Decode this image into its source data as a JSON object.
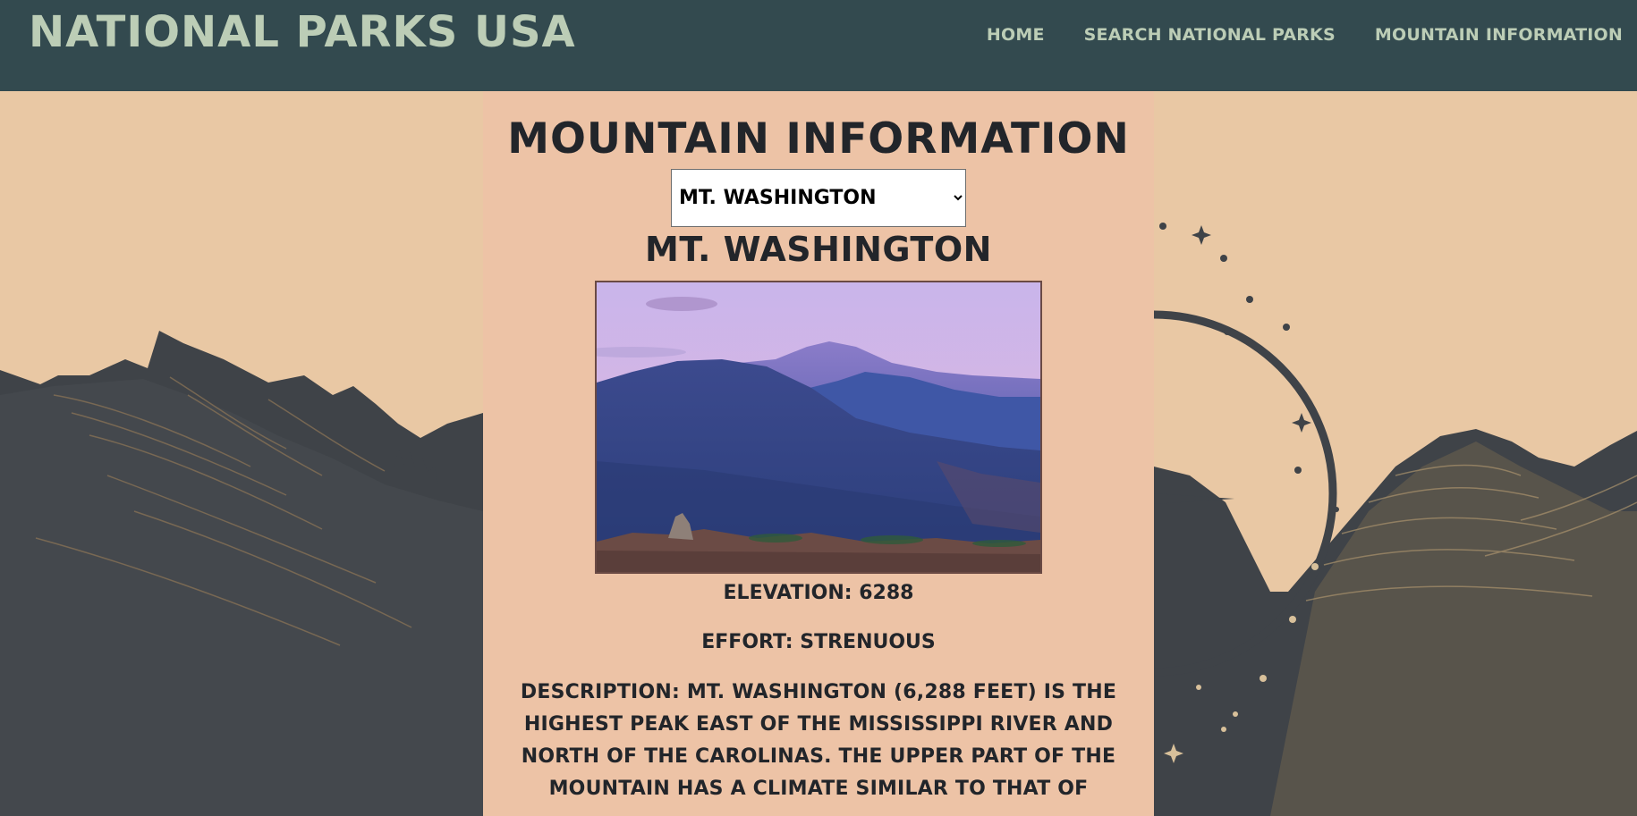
{
  "header": {
    "site_title": "National Parks USA",
    "nav": [
      {
        "label": "Home"
      },
      {
        "label": "Search National Parks"
      },
      {
        "label": "Mountain Information"
      }
    ]
  },
  "main": {
    "page_title": "Mountain Information",
    "select": {
      "selected": "Mt. Washington",
      "options": [
        "Mt. Washington"
      ]
    },
    "mountain_name": "Mt. Washington",
    "elevation_label": "Elevation:",
    "elevation_value": "6288",
    "effort_label": "Effort:",
    "effort_value": "Strenuous",
    "description_label": "Description:",
    "description_text": "Mt. Washington (6,288 feet) is the highest peak east of the Mississippi River and north of the Carolinas. The upper part of the mountain has a climate similar to that of"
  },
  "colors": {
    "header_bg": "#334a4f",
    "header_text": "#bccdb6",
    "page_bg": "#e9c8a4",
    "panel_bg": "#edc3a6",
    "mountain_dark": "#3f4348",
    "text_dark": "#22252a"
  }
}
